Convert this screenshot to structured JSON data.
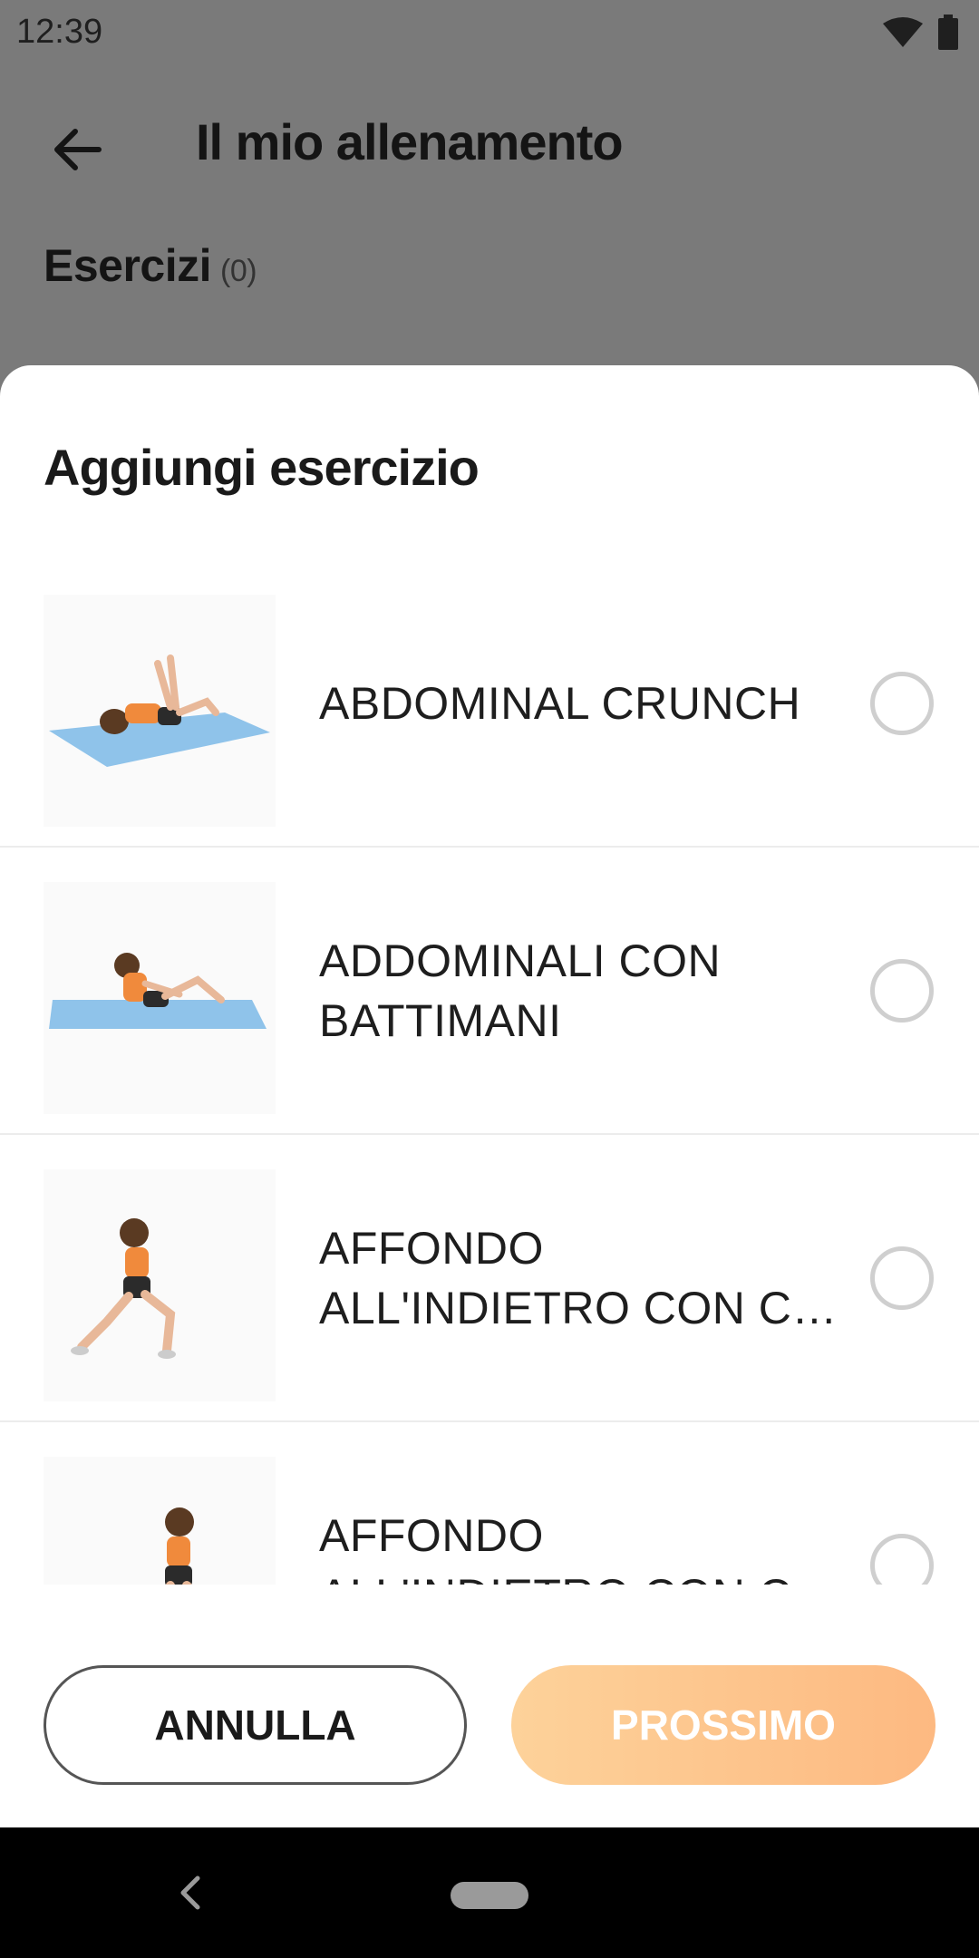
{
  "status_bar": {
    "time": "12:39",
    "icons": [
      "wifi-icon",
      "battery-icon"
    ]
  },
  "header": {
    "back_icon": "arrow-left-icon",
    "title": "Il mio allenamento"
  },
  "section": {
    "label": "Esercizi",
    "count": "(0)"
  },
  "sheet": {
    "title": "Aggiungi esercizio",
    "items": [
      {
        "name": "ABDOMINAL CRUNCH",
        "image": "abdominal-crunch-illustration"
      },
      {
        "name": "ADDOMINALI CON BATTIMANI",
        "image": "clap-crunch-illustration"
      },
      {
        "name": "AFFONDO ALL'INDIETRO CON C…",
        "image": "reverse-lunge-illustration"
      },
      {
        "name": "AFFONDO ALL'INDIETRO CON C…",
        "image": "reverse-lunge-2-illustration"
      }
    ],
    "cancel_label": "ANNULLA",
    "next_label": "PROSSIMO"
  },
  "colors": {
    "scrim": "#7a7a7a",
    "accent_start": "#fdd29a",
    "accent_end": "#fdb981",
    "mat": "#8fc3ea"
  },
  "nav_bar": {
    "icons": [
      "nav-back-icon",
      "home-pill"
    ]
  }
}
